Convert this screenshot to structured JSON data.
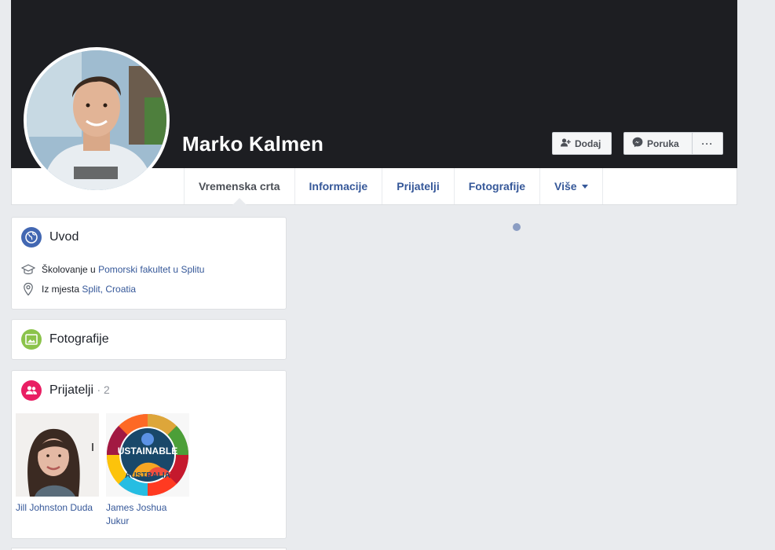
{
  "profile": {
    "name": "Marko Kalmen"
  },
  "actions": {
    "add_label": "Dodaj",
    "message_label": "Poruka",
    "more_label": "···"
  },
  "tabs": [
    {
      "label": "Vremenska crta"
    },
    {
      "label": "Informacije"
    },
    {
      "label": "Prijatelji"
    },
    {
      "label": "Fotografije"
    },
    {
      "label": "Više"
    }
  ],
  "intro": {
    "title": "Uvod",
    "education_prefix": "Školovanje u",
    "education_link": "Pomorski fakultet u Splitu",
    "from_prefix": "Iz mjesta",
    "from_link": "Split, Croatia"
  },
  "photos": {
    "title": "Fotografije"
  },
  "friends": {
    "title": "Prijatelji",
    "count": "· 2",
    "items": [
      {
        "name": "Jill Johnston Duda"
      },
      {
        "name": "James Joshua Jukur"
      }
    ],
    "badge_text_1": "USTAINABLE",
    "badge_text_2": "AUSTRALIA"
  },
  "colors": {
    "accent": "#365899",
    "globe": "#4267b2",
    "photos_icon": "#8bc34a",
    "friends_icon": "#e91e63"
  },
  "icons": {
    "add_friend": "add-friend-icon",
    "messenger": "messenger-icon",
    "globe": "globe-icon",
    "education": "graduation-cap-icon",
    "location": "location-pin-icon",
    "photos": "photo-icon",
    "friends": "friends-icon"
  }
}
